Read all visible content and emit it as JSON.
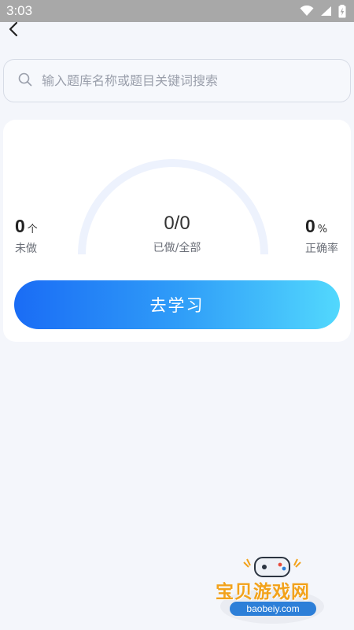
{
  "status_bar": {
    "time": "3:03",
    "icons": [
      "wifi-icon",
      "signal-icon",
      "battery-charging-icon"
    ]
  },
  "nav": {
    "back_icon": "chevron-left-icon"
  },
  "search": {
    "placeholder": "输入题库名称或题目关键词搜索",
    "icon": "search-icon"
  },
  "stats": {
    "undone": {
      "value": "0",
      "unit": "个",
      "label": "未做"
    },
    "progress": {
      "value": "0/0",
      "label": "已做/全部",
      "fraction": 0
    },
    "accuracy": {
      "value": "0",
      "unit": "%",
      "label": "正确率"
    }
  },
  "actions": {
    "study_label": "去学习"
  },
  "watermark": {
    "title": "宝贝游戏网",
    "url": "baobeiy.com"
  },
  "colors": {
    "background": "#f4f6fb",
    "gauge_track": "#edf2fd",
    "button_gradient_start": "#1a6cf5",
    "button_gradient_end": "#52d8fd",
    "watermark_text": "#f2a21b"
  }
}
